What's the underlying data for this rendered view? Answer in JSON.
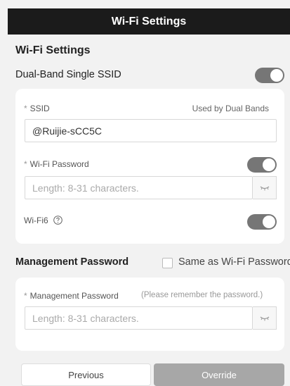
{
  "header": {
    "title": "Wi-Fi Settings"
  },
  "wifi": {
    "section_title": "Wi-Fi Settings",
    "dual_band_label": "Dual-Band Single SSID",
    "dual_band_enabled": true,
    "ssid_required": "*",
    "ssid_label": "SSID",
    "ssid_hint": "Used by Dual Bands",
    "ssid_value": "@Ruijie-sCC5C",
    "password_required": "*",
    "password_label": "Wi-Fi Password",
    "password_toggle_enabled": true,
    "password_placeholder": "Length: 8-31 characters.",
    "wifi6_label": "Wi-Fi6",
    "wifi6_enabled": true
  },
  "management": {
    "title": "Management Password",
    "same_as_wifi_label": "Same as Wi-Fi Password",
    "same_as_wifi_checked": false,
    "password_required": "*",
    "password_label": "Management Password",
    "password_hint": "(Please remember the password.)",
    "password_placeholder": "Length: 8-31 characters."
  },
  "footer": {
    "previous_label": "Previous",
    "override_label": "Override"
  },
  "colors": {
    "header_bg": "#1b1b1b",
    "toggle_on": "#767676",
    "override_bg": "#a7a7a7",
    "page_bg": "#f2f2f2"
  },
  "icons": {
    "help": "question-circle-icon",
    "eye": "eye-closed-icon"
  }
}
